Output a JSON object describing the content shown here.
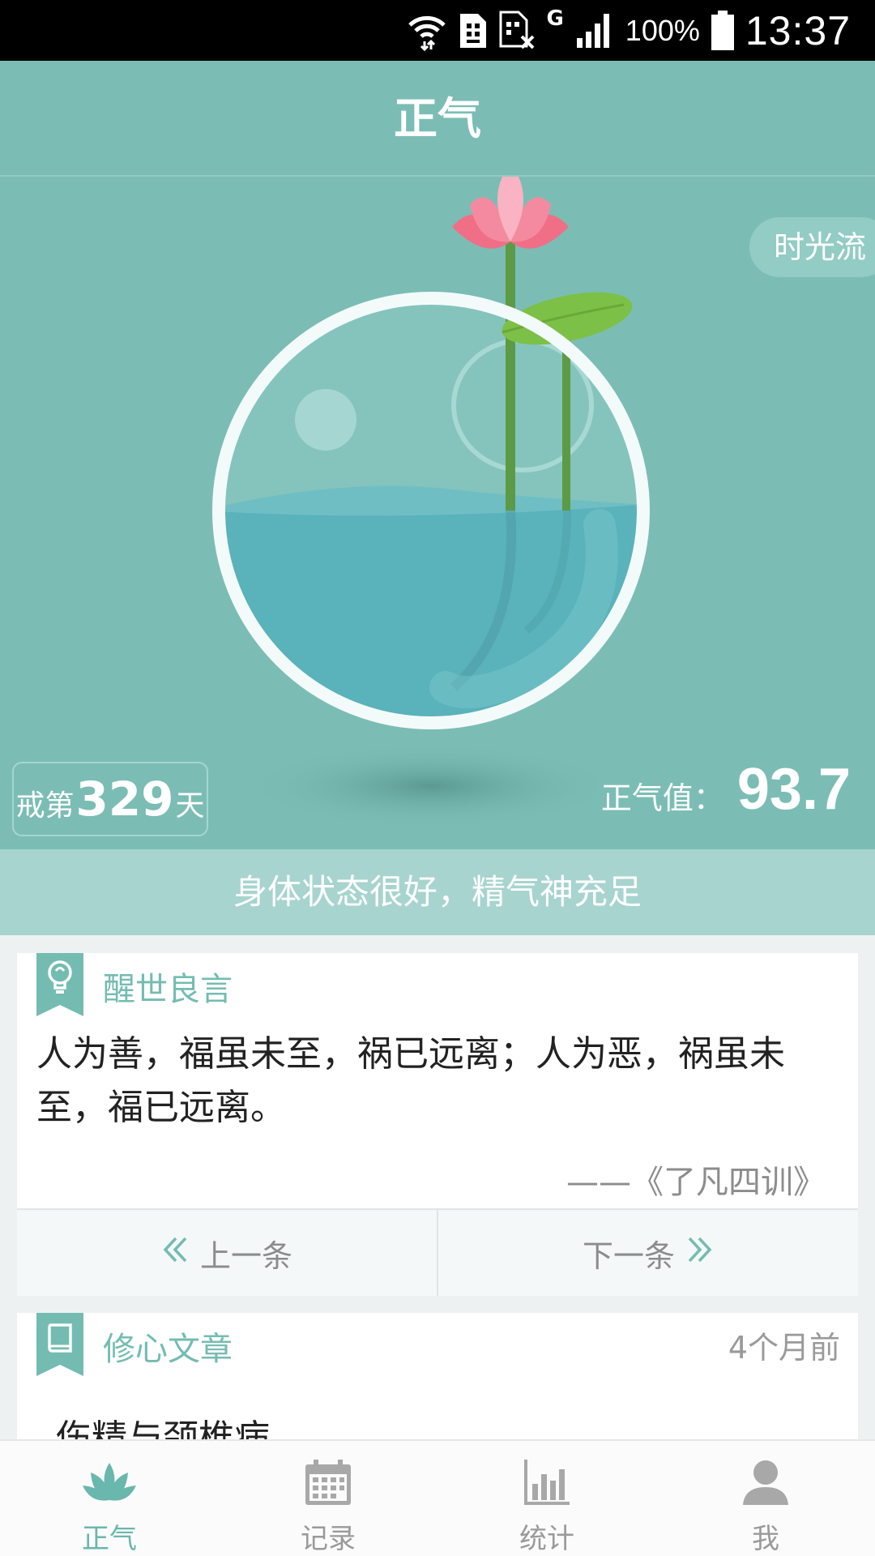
{
  "status_bar": {
    "battery_percent": "100%",
    "time": "13:37",
    "network_type": "G",
    "icons": [
      "wifi-icon",
      "sim-card-icon",
      "sim-card-no-service-icon",
      "signal-icon",
      "battery-icon"
    ]
  },
  "app_bar": {
    "title": "正气"
  },
  "hero": {
    "timeflow_label": "时光流",
    "days_prefix": "戒第",
    "days_count": "329",
    "days_suffix": "天",
    "zq_label": "正气值：",
    "zq_value": "93.7",
    "colors": {
      "background": "#7bbdb5",
      "water": "#5ab2bb",
      "lotus": "#f07a8f",
      "leaf": "#7cc047"
    }
  },
  "status_message": "身体状态很好，精气神充足",
  "quote_card": {
    "title": "醒世良言",
    "text": "人为善，福虽未至，祸已远离；人为恶，祸虽未至，福已远离。",
    "source": "——《了凡四训》",
    "prev_label": "上一条",
    "next_label": "下一条",
    "icon": "lightbulb-icon"
  },
  "article_card": {
    "title": "修心文章",
    "time": "4个月前",
    "article_title": "伤精与颈椎病",
    "icon": "book-icon"
  },
  "bottom_nav": {
    "items": [
      {
        "label": "正气",
        "icon": "lotus-icon",
        "active": true
      },
      {
        "label": "记录",
        "icon": "calendar-icon",
        "active": false
      },
      {
        "label": "统计",
        "icon": "bar-chart-icon",
        "active": false
      },
      {
        "label": "我",
        "icon": "person-icon",
        "active": false
      }
    ]
  },
  "accent_color": "#74bcb2"
}
